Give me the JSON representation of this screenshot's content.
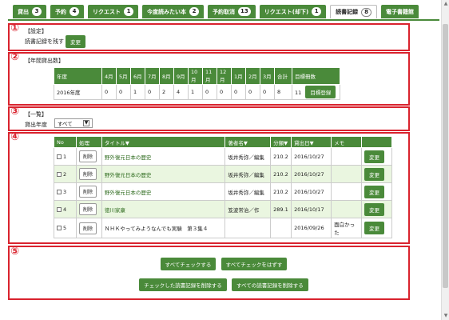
{
  "tabs": [
    {
      "label": "貸出",
      "count": "3",
      "active": false
    },
    {
      "label": "予約",
      "count": "4",
      "active": false
    },
    {
      "label": "リクエスト",
      "count": "1",
      "active": false
    },
    {
      "label": "今度読みたい本",
      "count": "2",
      "active": false
    },
    {
      "label": "予約取消",
      "count": "13",
      "active": false
    },
    {
      "label": "リクエスト(却下)",
      "count": "1",
      "active": false
    },
    {
      "label": "読書記録",
      "count": "8",
      "active": true
    },
    {
      "label": "電子書籍館",
      "count": "",
      "active": false
    }
  ],
  "section1": {
    "marker": "①",
    "heading": "【設定】",
    "text": "読書記録を残す",
    "button": "変更"
  },
  "section2": {
    "marker": "②",
    "heading": "【年間貸出数】",
    "headers": [
      "年度",
      "4月",
      "5月",
      "6月",
      "7月",
      "8月",
      "9月",
      "10月",
      "11月",
      "12月",
      "1月",
      "2月",
      "3月",
      "合計",
      "目標冊数"
    ],
    "row": [
      "2016年度",
      "0",
      "0",
      "1",
      "0",
      "2",
      "4",
      "1",
      "0",
      "0",
      "0",
      "0",
      "0",
      "8"
    ],
    "goal": "11",
    "goal_button": "目標登録"
  },
  "section3": {
    "marker": "③",
    "heading": "【一覧】",
    "filter_label": "貸出年度",
    "filter_value": "すべて"
  },
  "section4": {
    "marker": "④",
    "headers": [
      "No",
      "処理",
      "タイトル▼",
      "著者名▼",
      "分類▼",
      "貸出日▼",
      "メモ",
      ""
    ],
    "delete_label": "削除",
    "edit_label": "変更",
    "rows": [
      {
        "no": "1",
        "title": "野外復元日本の歴史",
        "author": "坂井秀弥／編集",
        "class": "210.2",
        "date": "2016/10/27",
        "memo": ""
      },
      {
        "no": "2",
        "title": "野外復元日本の歴史",
        "author": "坂井秀弥／編集",
        "class": "210.2",
        "date": "2016/10/27",
        "memo": ""
      },
      {
        "no": "3",
        "title": "野外復元日本の歴史",
        "author": "坂井秀弥／編集",
        "class": "210.2",
        "date": "2016/10/27",
        "memo": ""
      },
      {
        "no": "4",
        "title": "徳川家康",
        "author": "笈波常治／作",
        "class": "289.1",
        "date": "2016/10/17",
        "memo": ""
      },
      {
        "no": "5",
        "title": "ＮＨＫやってみようなんでも実験　第３集４",
        "author": "",
        "class": "",
        "date": "2016/09/26",
        "memo": "面白かった"
      }
    ]
  },
  "section5": {
    "marker": "⑤",
    "check_all": "すべてチェックする",
    "uncheck_all": "すべてチェックをはずす",
    "delete_checked": "チェックした読書記録を削除する",
    "delete_all": "すべての読書記録を削除する"
  },
  "colors": {
    "tab_green": "#4a8a3a",
    "annotation_red": "#d9232e",
    "row_highlight": "#eaf6e0"
  }
}
